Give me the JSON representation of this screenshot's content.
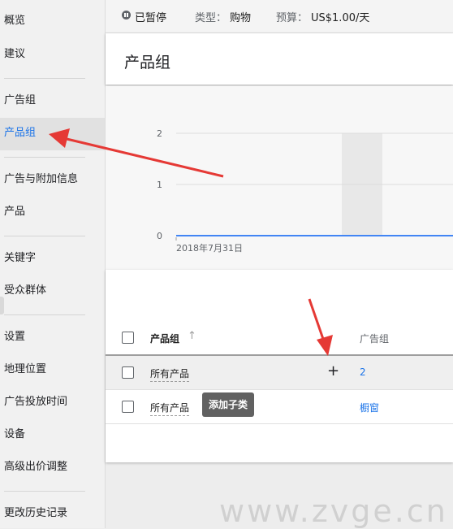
{
  "sidebar": {
    "items": [
      {
        "label": "概览"
      },
      {
        "label": "建议"
      },
      {
        "label": "广告组"
      },
      {
        "label": "产品组"
      },
      {
        "label": "广告与附加信息"
      },
      {
        "label": "产品"
      },
      {
        "label": "关键字"
      },
      {
        "label": "受众群体"
      },
      {
        "label": "设置"
      },
      {
        "label": "地理位置"
      },
      {
        "label": "广告投放时间"
      },
      {
        "label": "设备"
      },
      {
        "label": "高级出价调整"
      },
      {
        "label": "更改历史记录"
      }
    ],
    "active_index": 3
  },
  "status_bar": {
    "status": "已暂停",
    "type_label": "类型：",
    "type_value": "购物",
    "budget_label": "预算：",
    "budget_value": "US$1.00/天"
  },
  "page": {
    "title": "产品组"
  },
  "chart_data": {
    "type": "line",
    "y_ticks": [
      "0",
      "1",
      "2"
    ],
    "ylim": [
      0,
      2
    ],
    "x_label": "2018年7月31日",
    "series": [
      {
        "values": [
          0,
          0
        ]
      }
    ],
    "colors": {
      "line": "#4285f4",
      "highlight": "#e8e8e8"
    }
  },
  "table": {
    "columns": [
      "产品组",
      "广告组"
    ],
    "rows": [
      {
        "name": "所有产品",
        "ad_group": "2"
      },
      {
        "name": "所有产品",
        "ad_group": "橱窗"
      }
    ]
  },
  "tooltip": {
    "text": "添加子类"
  },
  "watermark": "www.zvge.cn",
  "colors": {
    "accent": "#1a73e8",
    "arrow": "#e53935"
  }
}
